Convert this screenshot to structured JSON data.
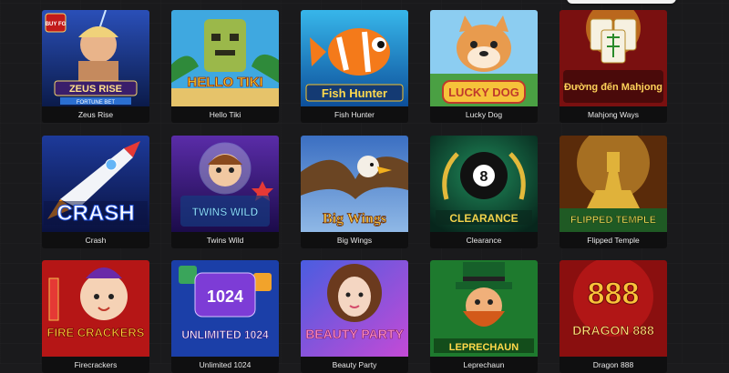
{
  "games": [
    {
      "title": "Zeus Rise",
      "art_text": "ZEUS RISE",
      "art_subtext": "FORTUNE BET",
      "badge": "BUY FG"
    },
    {
      "title": "Hello Tiki",
      "art_text": "HELLO TIKI"
    },
    {
      "title": "Fish Hunter",
      "art_text": "Fish Hunter"
    },
    {
      "title": "Lucky Dog",
      "art_text": "LUCKY DOG"
    },
    {
      "title": "Mahjong Ways",
      "art_text": "Đường đến Mahjong"
    },
    {
      "title": "Crash",
      "art_text": "CRASH"
    },
    {
      "title": "Twins Wild",
      "art_text": "TWINS WILD"
    },
    {
      "title": "Big Wings",
      "art_text": "Big Wings"
    },
    {
      "title": "Clearance",
      "art_text": "CLEARANCE",
      "art_number": "8"
    },
    {
      "title": "Flipped Temple",
      "art_text": "FLIPPED TEMPLE"
    },
    {
      "title": "Firecrackers",
      "art_text": "FIRE CRACKERS"
    },
    {
      "title": "Unlimited 1024",
      "art_text": "UNLIMITED 1024",
      "art_number": "1024"
    },
    {
      "title": "Beauty Party",
      "art_text": "BEAUTY PARTY"
    },
    {
      "title": "Leprechaun",
      "art_text": "LEPRECHAUN"
    },
    {
      "title": "Dragon 888",
      "art_text": "DRAGON 888",
      "art_number": "888"
    }
  ],
  "colors": {
    "page_bg": "#1b1b1d",
    "label_text": "#e9e9e9",
    "search_pill": "#f2f2f2"
  }
}
